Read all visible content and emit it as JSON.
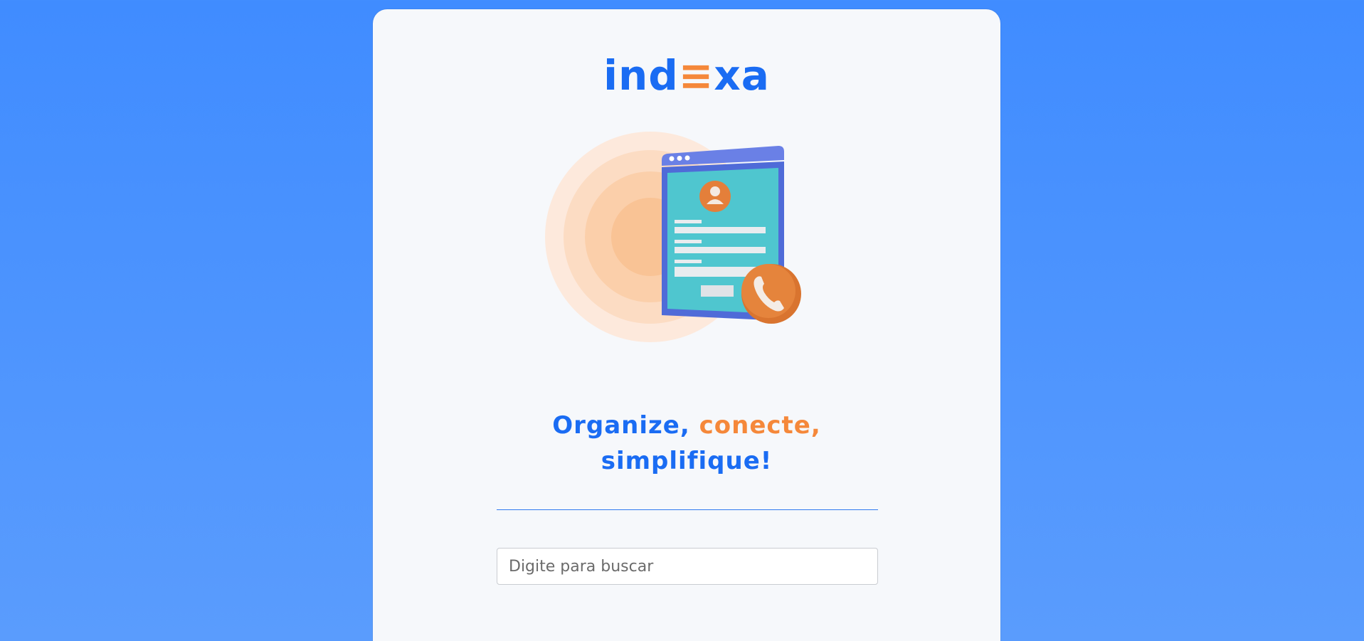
{
  "logo": {
    "part1": "ind",
    "part2": "≡",
    "part3": "xa"
  },
  "tagline": {
    "word1": "Organize,",
    "word2": "conecte,",
    "word3": "simplifique!"
  },
  "search": {
    "placeholder": "Digite para buscar",
    "value": ""
  },
  "colors": {
    "brand_blue": "#1a6cf3",
    "brand_orange": "#f5883a",
    "background": "#408cff"
  },
  "illustration": {
    "icon": "contact-form-phone-icon"
  }
}
